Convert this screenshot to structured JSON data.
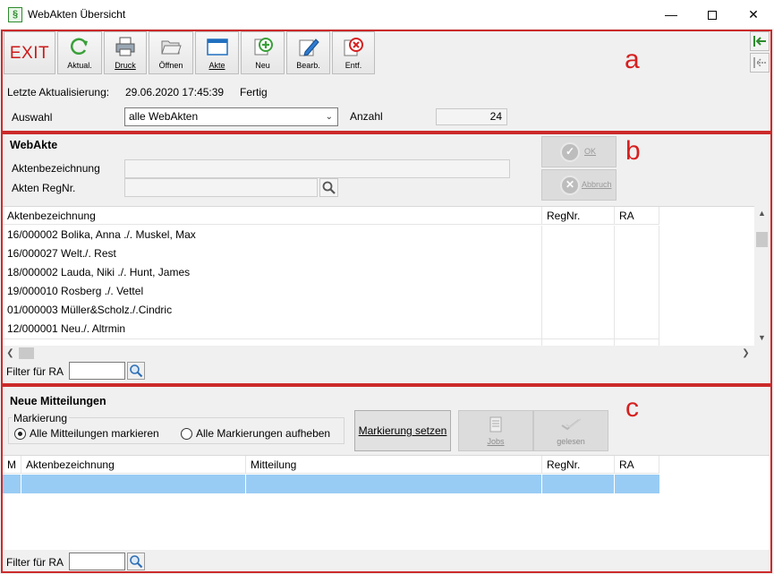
{
  "window": {
    "title": "WebAkten Übersicht",
    "app_icon": "§"
  },
  "annotations": {
    "a": "a",
    "b": "b",
    "c": "c"
  },
  "toolbar": {
    "exit": "EXIT",
    "refresh": "Aktual.",
    "print": "Druck",
    "open": "Öffnen",
    "akte": "Akte",
    "new": "Neu",
    "edit": "Bearb.",
    "delete": "Entf."
  },
  "status": {
    "last_update_label": "Letzte Aktualisierung:",
    "last_update_value": "29.06.2020 17:45:39",
    "state": "Fertig"
  },
  "selection": {
    "label": "Auswahl",
    "value": "alle WebAkten",
    "count_label": "Anzahl",
    "count_value": "24"
  },
  "webakte": {
    "heading": "WebAkte",
    "name_label": "Aktenbezeichnung",
    "regnr_label": "Akten RegNr.",
    "ok": "OK",
    "cancel": "Abbruch"
  },
  "akten_table": {
    "columns": [
      "Aktenbezeichnung",
      "RegNr.",
      "RA"
    ],
    "rows": [
      [
        "16/000002 Bolika, Anna ./. Muskel, Max",
        "",
        ""
      ],
      [
        "16/000027 Welt./. Rest",
        "",
        ""
      ],
      [
        "18/000002 Lauda, Niki ./. Hunt, James",
        "",
        ""
      ],
      [
        "19/000010 Rosberg ./. Vettel",
        "",
        ""
      ],
      [
        "01/000003 Müller&Scholz./.Cindric",
        "",
        ""
      ],
      [
        "12/000001 Neu./. Altrmin",
        "",
        ""
      ]
    ]
  },
  "filter": {
    "label": "Filter für RA"
  },
  "mitteilungen": {
    "heading": "Neue Mitteilungen",
    "group_label": "Markierung",
    "radio_mark_all": "Alle Mitteilungen markieren",
    "radio_unmark_all": "Alle Markierungen aufheben",
    "set_mark": "Markierung setzen",
    "jobs": "Jobs",
    "read": "gelesen",
    "columns": [
      "M",
      "Aktenbezeichnung",
      "Mitteilung",
      "RegNr.",
      "RA"
    ]
  }
}
